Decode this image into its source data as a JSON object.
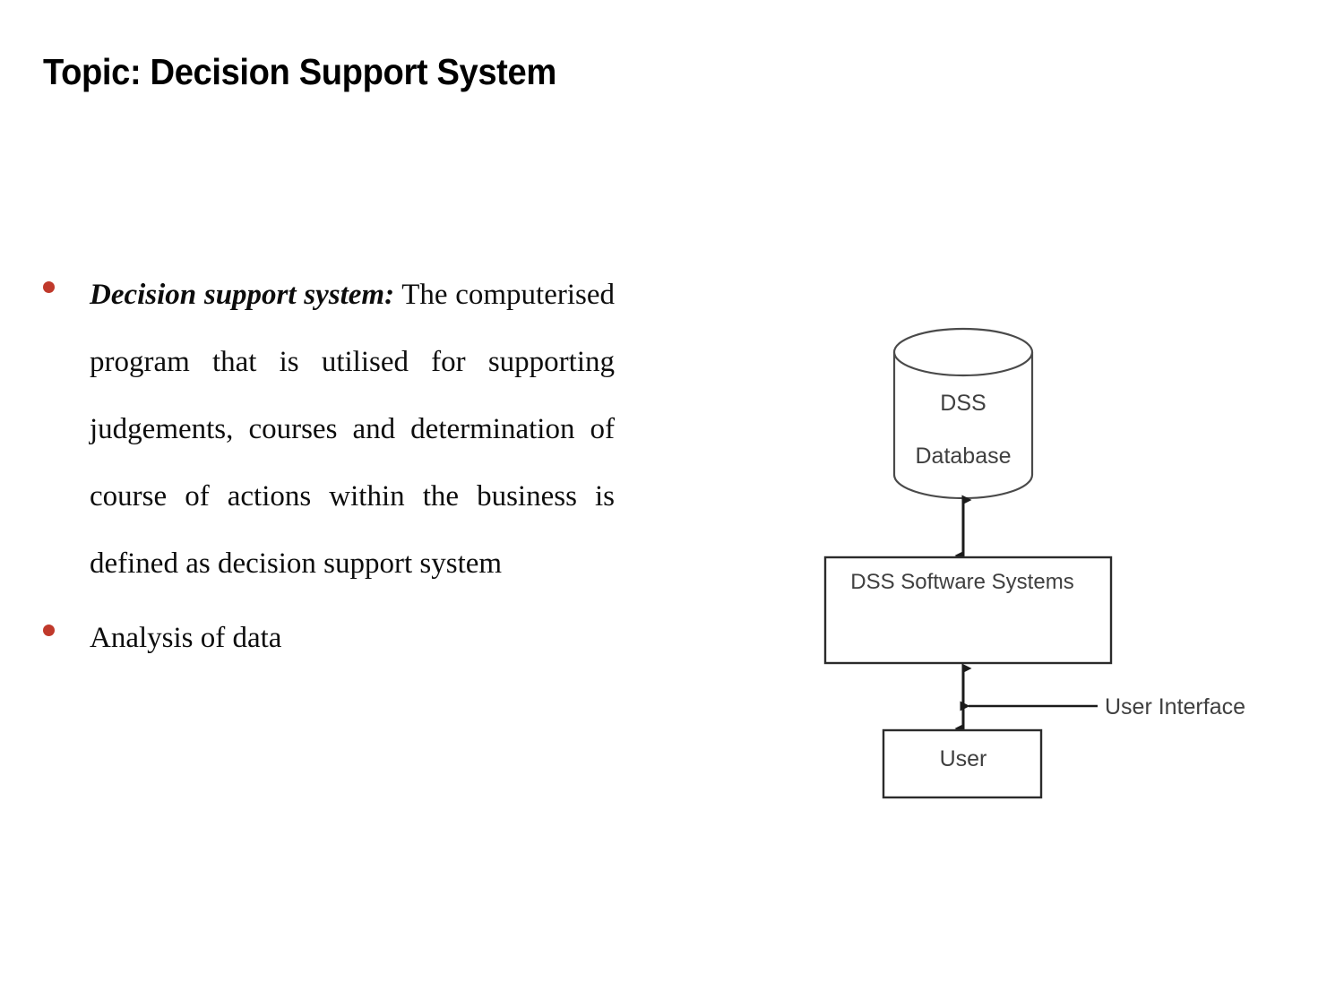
{
  "slide": {
    "title": "Topic: Decision Support System",
    "background_color": "#ffffff",
    "bullet_color": "#C0392B",
    "text_color": "#0d0d0d"
  },
  "content": {
    "bullets": [
      {
        "lead_term": "Decision support system:",
        "body": " The computerised program that is utilised for supporting judgements, courses and determination of course of actions within the business is defined as decision support system",
        "justified": true
      },
      {
        "lead_term": "",
        "body": "Analysis of data",
        "justified": false
      }
    ]
  },
  "diagram": {
    "title": "DSS architecture diagram",
    "line_color": "#3f3f3f",
    "label_color": "#3f3f3f",
    "nodes": [
      {
        "id": "dss-database",
        "shape": "cylinder",
        "label_line_1": "DSS",
        "label_line_2": "Database"
      },
      {
        "id": "dss-software-systems",
        "shape": "rectangle",
        "label": "DSS Software Systems"
      },
      {
        "id": "user",
        "shape": "rectangle",
        "label": "User"
      }
    ],
    "annotations": [
      {
        "id": "user-interface",
        "label": "User Interface"
      }
    ],
    "connectors": [
      {
        "id": "db-to-software",
        "from": "dss-database",
        "to": "dss-software-systems",
        "arrow": "double"
      },
      {
        "id": "software-to-user",
        "from": "dss-software-systems",
        "to": "user",
        "arrow": "double"
      },
      {
        "id": "ui-pointer",
        "from": "user-interface",
        "to": "software-to-user",
        "arrow": "single-left"
      }
    ]
  }
}
